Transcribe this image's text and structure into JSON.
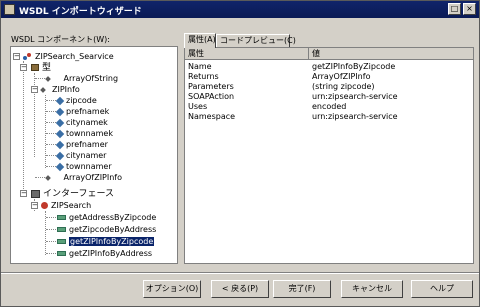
{
  "window": {
    "title": "WSDL インポートウィザード"
  },
  "left": {
    "label": "WSDL コンポーネント(W):",
    "tree": {
      "root": "ZIPSearch_Searvice",
      "types_group": "型",
      "array_of_string": "ArrayOfString",
      "zipinfo": "ZIPInfo",
      "zipinfo_fields": [
        "zipcode",
        "prefnamek",
        "citynamek",
        "townnamek",
        "prefnamer",
        "citynamer",
        "townnamer"
      ],
      "array_of_zipinfo": "ArrayOfZIPInfo",
      "interfaces_group": "インターフェース",
      "zipsearch": "ZIPSearch",
      "operations": [
        "getAddressByZipcode",
        "getZipcodeByAddress",
        "getZIPInfoByZipcode",
        "getZIPInfoByAddress"
      ],
      "selected_operation": "getZIPInfoByZipcode"
    }
  },
  "right": {
    "tabs": [
      "属性(A)",
      "コードプレビュー(C)"
    ],
    "active_tab": "属性(A)",
    "columns": [
      "属性",
      "値"
    ],
    "rows": [
      {
        "name": "Name",
        "value": "getZIPInfoByZipcode"
      },
      {
        "name": "Returns",
        "value": "ArrayOfZIPInfo"
      },
      {
        "name": "Parameters",
        "value": "(string zipcode)"
      },
      {
        "name": "SOAPAction",
        "value": "urn:zipsearch-service"
      },
      {
        "name": "Uses",
        "value": "encoded"
      },
      {
        "name": "Namespace",
        "value": "urn:zipsearch-service"
      }
    ]
  },
  "buttons": {
    "options": "オプション(O)",
    "back": "< 戻る(P)",
    "finish": "完了(F)",
    "cancel": "キャンセル",
    "help": "ヘルプ"
  }
}
